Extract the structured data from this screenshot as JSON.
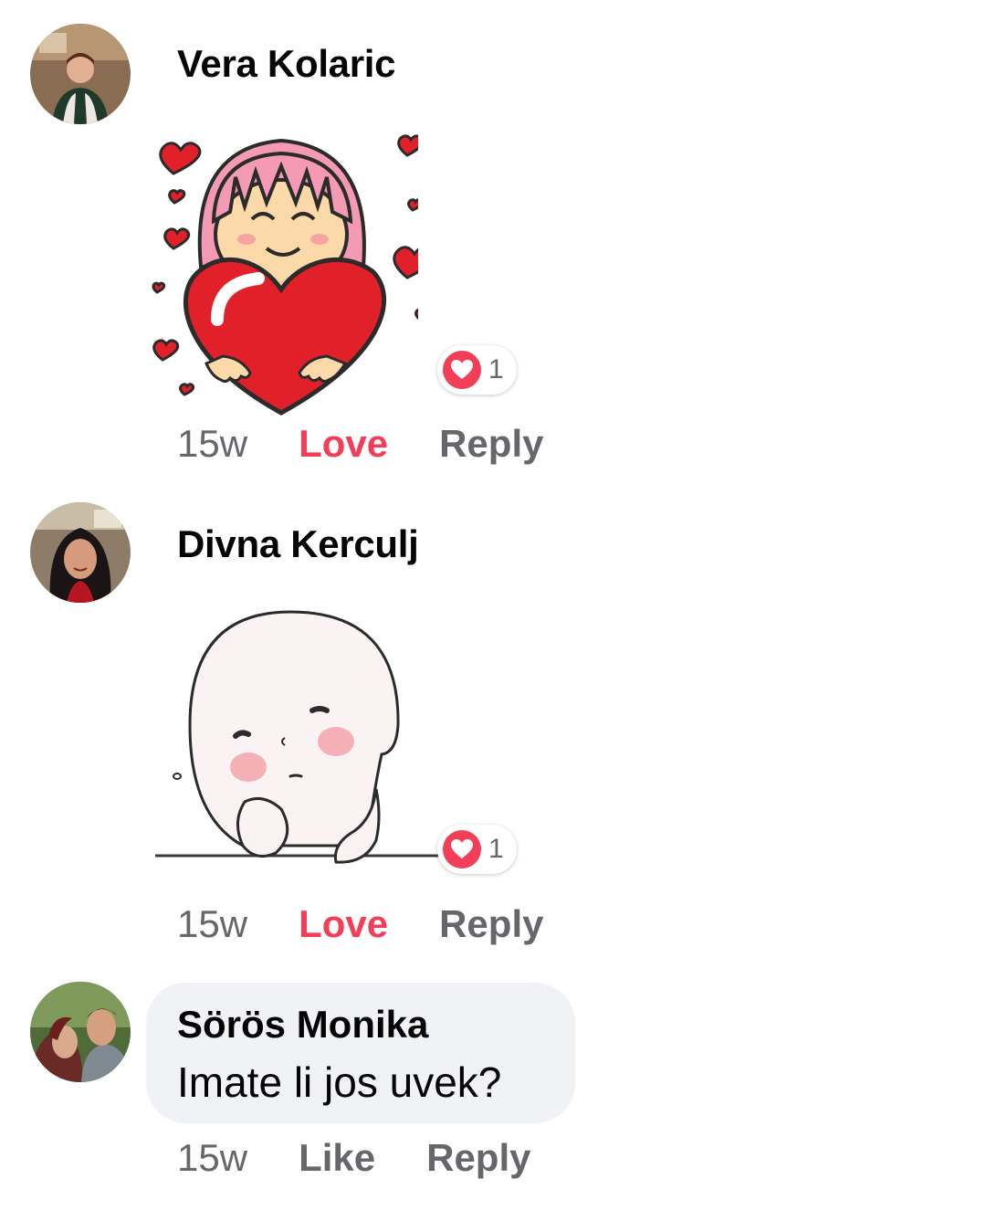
{
  "comments": [
    {
      "author": "Vera Kolaric",
      "avatar_icon": "avatar-photo-icon",
      "sticker_icon": "girl-holding-heart-sticker-icon",
      "reaction": {
        "icon": "love-reaction-icon",
        "count": "1"
      },
      "time": "15w",
      "react_label": "Love",
      "react_color": "#f33e58",
      "reply_label": "Reply"
    },
    {
      "author": "Divna Kerculj",
      "avatar_icon": "avatar-photo-icon",
      "sticker_icon": "pondering-blob-sticker-icon",
      "reaction": {
        "icon": "love-reaction-icon",
        "count": "1"
      },
      "time": "15w",
      "react_label": "Love",
      "react_color": "#f33e58",
      "reply_label": "Reply"
    },
    {
      "author": "Sörös Monika",
      "avatar_icon": "avatar-photo-icon",
      "text": "Imate li jos uvek?",
      "time": "15w",
      "react_label": "Like",
      "reply_label": "Reply"
    }
  ],
  "colors": {
    "love": "#f33e58",
    "meta_text": "#65676b",
    "bubble_bg": "#f0f2f5"
  }
}
